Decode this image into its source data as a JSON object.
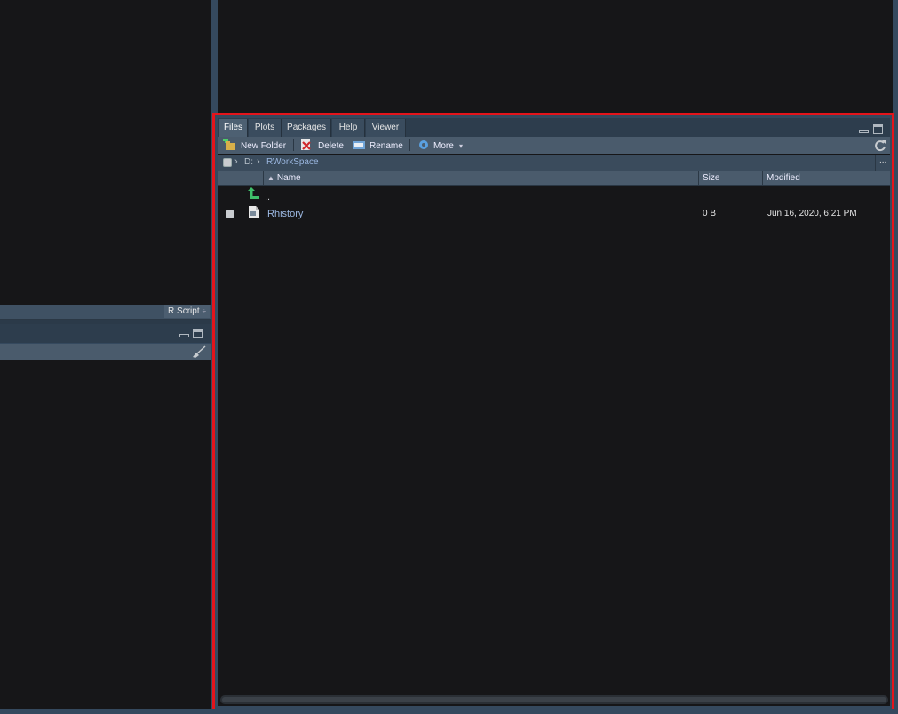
{
  "left_panel": {
    "source_type_label": "R Script",
    "source_type_arrow": "÷"
  },
  "files_pane": {
    "tabs": [
      {
        "label": "Files",
        "active": true
      },
      {
        "label": "Plots",
        "active": false
      },
      {
        "label": "Packages",
        "active": false
      },
      {
        "label": "Help",
        "active": false
      },
      {
        "label": "Viewer",
        "active": false
      }
    ],
    "toolbar": {
      "new_folder": "New Folder",
      "delete": "Delete",
      "rename": "Rename",
      "more": "More",
      "more_arrow": "▾"
    },
    "breadcrumb": {
      "drive": "D:",
      "folder": "RWorkSpace",
      "more": "..."
    },
    "columns": {
      "name": "Name",
      "size": "Size",
      "modified": "Modified"
    },
    "parent_dir_label": "..",
    "files": [
      {
        "name": ".Rhistory",
        "size": "0 B",
        "modified": "Jun 16, 2020, 6:21 PM"
      }
    ]
  },
  "colors": {
    "highlight": "#e4141b",
    "background": "#161618",
    "accent_blue": "#9bb7e0"
  }
}
